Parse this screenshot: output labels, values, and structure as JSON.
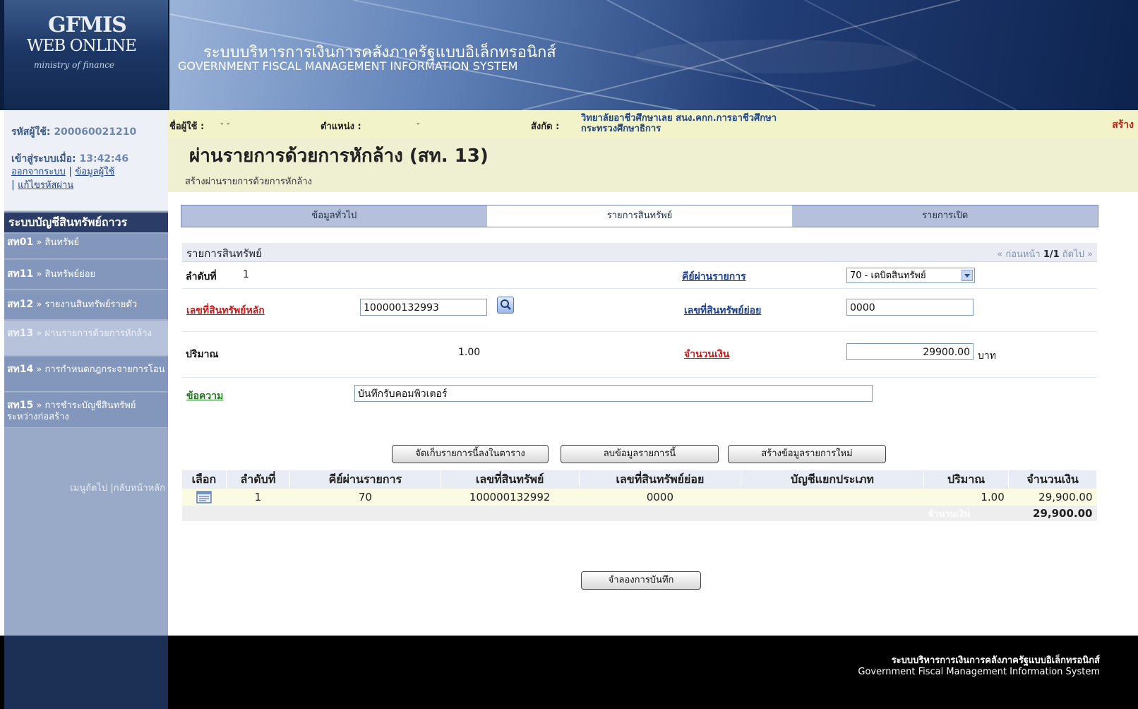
{
  "header": {
    "logo_line1": "GFMIS",
    "logo_line2": "WEB ONLINE",
    "logo_line3": "ministry of finance",
    "title_th": "ระบบบริหารการเงินการคลังภาครัฐแบบอิเล็กทรอนิกส์",
    "title_en": "GOVERNMENT FISCAL MANAGEMENT INFORMATION SYSTEM"
  },
  "user": {
    "id_label": "รหัสผู้ใช้:",
    "id_value": "200060021210",
    "login_label": "เข้าสู่ระบบเมื่อ:",
    "login_time": "13:42:46",
    "logout": "ออกจากระบบ",
    "user_info": "ข้อมูลผู้ใช้",
    "change_password": "แก้ไขรหัสผ่าน"
  },
  "sidebar": {
    "title": "ระบบบัญชีสินทรัพย์ถาวร",
    "items": [
      {
        "code": "สท01",
        "label": "สินทรัพย์"
      },
      {
        "code": "สท11",
        "label": "สินทรัพย์ย่อย"
      },
      {
        "code": "สท12",
        "label": "รายงานสินทรัพย์รายตัว"
      },
      {
        "code": "สท13",
        "label": "ผ่านรายการด้วยการหักล้าง"
      },
      {
        "code": "สท14",
        "label": "การกำหนดกฎกระจายการโอน"
      },
      {
        "code": "สท15",
        "label": "การชำระบัญชีสินทรัพย์ระหว่างก่อสร้าง"
      }
    ],
    "sep": "»",
    "next_menu": "เมนูถัดไป",
    "back_home": "กลับหน้าหลัก"
  },
  "info": {
    "user_label": "ชื่อผู้ใช้ :",
    "user_value": "- -",
    "position_label": "ตำแหน่ง :",
    "position_value": "-",
    "org_label": "สังกัด :",
    "org_line1": "วิทยาลัยอาชีวศึกษาเลย สนง.คกก.การอาชีวศึกษา",
    "org_line2": "กระทรวงศึกษาธิการ",
    "mode": "สร้าง"
  },
  "page": {
    "title": "ผ่านรายการด้วยการหักล้าง (สท. 13)",
    "subtitle": "สร้างผ่านรายการด้วยการหักล้าง"
  },
  "tabs": [
    {
      "label": "ข้อมูลทั่วไป"
    },
    {
      "label": "รายการสินทรัพย์"
    },
    {
      "label": "รายการเปิด"
    }
  ],
  "section": {
    "title": "รายการสินทรัพย์",
    "prev": "« ก่อนหน้า",
    "page": "1/1",
    "next": "ถัดไป »"
  },
  "form": {
    "seq_label": "ลำดับที่",
    "seq_value": "1",
    "posting_key_label": "คีย์ผ่านรายการ",
    "posting_key_value": "70 - เดบิตสินทรัพย์",
    "asset_no_label": "เลขที่สินทรัพย์หลัก",
    "asset_no_value": "100000132993",
    "sub_asset_label": "เลขที่สินทรัพย์ย่อย",
    "sub_asset_value": "0000",
    "qty_label": "ปริมาณ",
    "qty_value": "1.00",
    "amount_label": "จำนวนเงิน",
    "amount_value": "29900.00",
    "currency": "บาท",
    "text_label": "ข้อความ",
    "text_value": "บันทึกรับคอมพิวเตอร์"
  },
  "buttons": {
    "save_row": "จัดเก็บรายการนี้ลงในตาราง",
    "delete_row": "ลบข้อมูลรายการนี้",
    "new_row": "สร้างข้อมูลรายการใหม่",
    "simulate": "จำลองการบันทึก"
  },
  "table": {
    "headers": [
      "เลือก",
      "ลำดับที่",
      "คีย์ผ่านรายการ",
      "เลขที่สินทรัพย์",
      "เลขที่สินทรัพย์ย่อย",
      "บัญชีแยกประเภท",
      "ปริมาณ",
      "จำนวนเงิน"
    ],
    "rows": [
      {
        "seq": "1",
        "key": "70",
        "asset": "100000132992",
        "sub": "0000",
        "gl": "",
        "qty": "1.00",
        "amount": "29,900.00"
      }
    ],
    "total_label": "จำนวนเงิน",
    "total_value": "29,900.00"
  },
  "footer": {
    "line1": "ระบบบริหารการเงินการคลังภาครัฐแบบอิเล็กทรอนิกส์",
    "line2": "Government Fiscal Management Information System"
  },
  "colors": {
    "header_dark": "#0c1e3e",
    "sidebar": "#8396bb",
    "info_bar": "#f2f3c9",
    "required_label": "#c01e1e",
    "link_label": "#1d3f8c",
    "total_label_bg": "#1f3360"
  }
}
